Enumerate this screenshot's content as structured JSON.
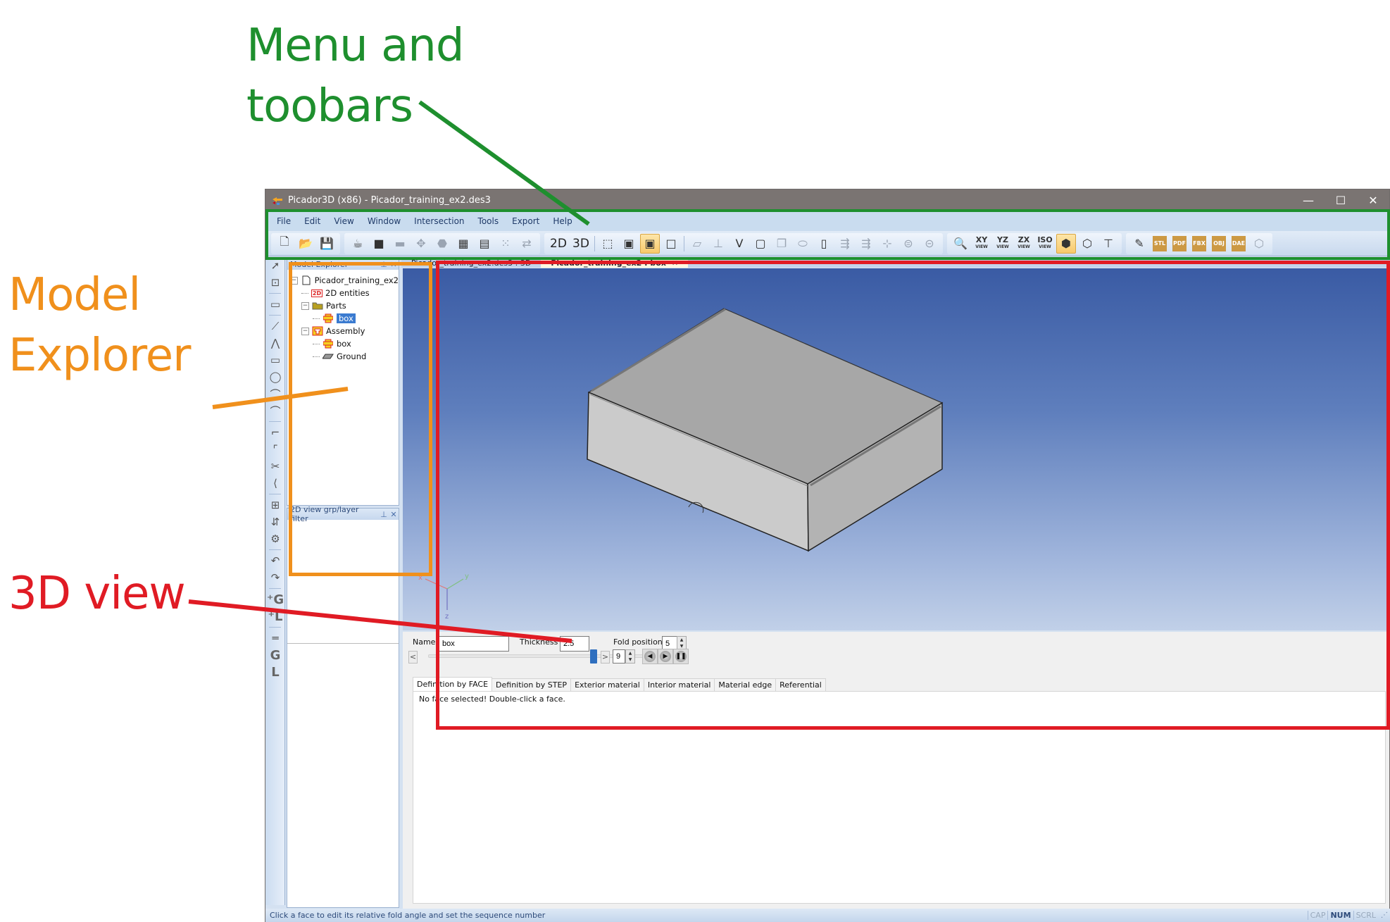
{
  "annotations": {
    "menu_toolbars": [
      "Menu and",
      "toobars"
    ],
    "model_explorer": [
      "Model",
      "Explorer"
    ],
    "view3d": "3D view",
    "colors": {
      "green": "#1e8f2e",
      "orange": "#f0901c",
      "red": "#e01b24"
    }
  },
  "window": {
    "title": "Picador3D (x86) - Picador_training_ex2.des3",
    "controls": {
      "minimize": "—",
      "maximize": "☐",
      "close": "✕"
    }
  },
  "menu": [
    "File",
    "Edit",
    "View",
    "Window",
    "Intersection",
    "Tools",
    "Export",
    "Help"
  ],
  "toolbar": {
    "file_group": [
      {
        "name": "new-document-icon",
        "glyph": "🗋"
      },
      {
        "name": "open-file-icon",
        "glyph": "📂"
      },
      {
        "name": "save-icon",
        "glyph": "💾"
      }
    ],
    "model_group": [
      {
        "name": "teapot-icon",
        "glyph": "☕"
      },
      {
        "name": "solid-3d-icon",
        "glyph": "■"
      },
      {
        "name": "mold-icon",
        "glyph": "▬",
        "disabled": true
      },
      {
        "name": "rotate-part-icon",
        "glyph": "✥",
        "disabled": true
      },
      {
        "name": "shape-icon",
        "glyph": "⬣",
        "disabled": true
      },
      {
        "name": "parts-stack-icon",
        "glyph": "▦"
      },
      {
        "name": "parts-group-icon",
        "glyph": "▤"
      },
      {
        "name": "grid-parts-icon",
        "glyph": "⁙",
        "disabled": true
      },
      {
        "name": "swap-icon",
        "glyph": "⇄",
        "disabled": true
      }
    ],
    "mode_2d": "2D",
    "mode_3d": "3D",
    "render_group": [
      {
        "name": "wireframe-icon",
        "glyph": "⬚"
      },
      {
        "name": "shaded-box-icon",
        "glyph": "▣"
      },
      {
        "name": "shaded-edges-icon",
        "glyph": "▣",
        "active": true
      },
      {
        "name": "hidden-lines-icon",
        "glyph": "□"
      }
    ],
    "fold_group": [
      {
        "name": "parts-icon",
        "glyph": "▱",
        "disabled": true
      },
      {
        "name": "dimension-icon",
        "glyph": "⊥",
        "disabled": true
      },
      {
        "name": "fold-icon",
        "glyph": "V"
      },
      {
        "name": "box-select-icon",
        "glyph": "▢"
      },
      {
        "name": "copy-icon",
        "glyph": "❐",
        "disabled": true
      },
      {
        "name": "flatten-icon",
        "glyph": "⬭",
        "disabled": true
      },
      {
        "name": "cut-box-icon",
        "glyph": "▯"
      },
      {
        "name": "align-h-icon",
        "glyph": "⇶",
        "disabled": true
      },
      {
        "name": "align-v-icon",
        "glyph": "⇶",
        "disabled": true
      },
      {
        "name": "axis-icon",
        "glyph": "⊹",
        "disabled": true
      },
      {
        "name": "hang-icon",
        "glyph": "⊜",
        "disabled": true
      },
      {
        "name": "hang-alt-icon",
        "glyph": "⊝",
        "disabled": true
      }
    ],
    "view_group": [
      {
        "name": "zoom-icon",
        "glyph": "🔍"
      },
      {
        "name": "xy-view-icon",
        "label": "XY",
        "sub": "VIEW"
      },
      {
        "name": "yz-view-icon",
        "label": "YZ",
        "sub": "VIEW"
      },
      {
        "name": "zx-view-icon",
        "label": "ZX",
        "sub": "VIEW"
      },
      {
        "name": "iso-view-icon",
        "label": "ISO",
        "sub": "VIEW"
      },
      {
        "name": "perspective-cube-icon",
        "glyph": "⬢",
        "active": true
      },
      {
        "name": "explode-cube-icon",
        "glyph": "⬡"
      },
      {
        "name": "presentation-icon",
        "glyph": "⊤"
      }
    ],
    "export_group": [
      {
        "name": "edit-sign-icon",
        "glyph": "✎"
      },
      {
        "name": "export-stl-icon",
        "glyph": "STL"
      },
      {
        "name": "export-3dpdf-icon",
        "glyph": "PDF"
      },
      {
        "name": "export-fbx-icon",
        "glyph": "FBX"
      },
      {
        "name": "export-obj-icon",
        "glyph": "OBJ"
      },
      {
        "name": "export-dae-icon",
        "glyph": "DAE"
      },
      {
        "name": "hexagon-icon",
        "glyph": "⬡",
        "disabled": true
      }
    ]
  },
  "leftstrip": [
    {
      "name": "select-arrow-icon",
      "glyph": "➚"
    },
    {
      "name": "resize-sheet-icon",
      "glyph": "⊡"
    },
    {
      "sep": true
    },
    {
      "name": "eraser-icon",
      "glyph": "▭"
    },
    {
      "sep": true
    },
    {
      "name": "line-icon",
      "glyph": "⟋"
    },
    {
      "name": "polyline-icon",
      "glyph": "⋀"
    },
    {
      "name": "rectangle-icon",
      "glyph": "▭"
    },
    {
      "name": "circle-icon",
      "glyph": "◯"
    },
    {
      "name": "arc-icon",
      "glyph": "⌒"
    },
    {
      "name": "arc-3pt-icon",
      "glyph": "⌒"
    },
    {
      "sep": true
    },
    {
      "name": "corner-icon",
      "glyph": "⌐"
    },
    {
      "name": "fillet-icon",
      "glyph": "⌜"
    },
    {
      "name": "scissors-icon",
      "glyph": "✂"
    },
    {
      "name": "chamfer-icon",
      "glyph": "⟨"
    },
    {
      "sep": true
    },
    {
      "name": "crop-icon",
      "glyph": "⊞"
    },
    {
      "name": "flip-icon",
      "glyph": "⇵"
    },
    {
      "name": "machine-icon",
      "glyph": "⚙"
    },
    {
      "sep": true
    },
    {
      "name": "undo-icon",
      "glyph": "↶"
    },
    {
      "name": "redo-icon",
      "glyph": "↷"
    },
    {
      "sep": true
    },
    {
      "name": "add-group-icon",
      "glyph": "⁺G",
      "bold": true
    },
    {
      "name": "add-layer-icon",
      "glyph": "⁺L",
      "bold": true
    },
    {
      "sep": true
    },
    {
      "name": "parallel-icon",
      "glyph": "═"
    },
    {
      "name": "group-icon",
      "glyph": "G",
      "bold": true
    },
    {
      "name": "layer-icon",
      "glyph": "L",
      "bold": true
    }
  ],
  "model_explorer": {
    "title": "Model Explorer",
    "pin": "⊥",
    "close": "✕",
    "tree": [
      {
        "label": "Picador_training_ex2",
        "level": 0,
        "toggle": "−",
        "icon": "document"
      },
      {
        "label": "2D entities",
        "level": 1,
        "icon": "2d"
      },
      {
        "label": "Parts",
        "level": 1,
        "toggle": "−",
        "icon": "folder"
      },
      {
        "label": "box",
        "level": 2,
        "icon": "part",
        "selected": true
      },
      {
        "label": "Assembly",
        "level": 1,
        "toggle": "−",
        "icon": "assembly"
      },
      {
        "label": "box",
        "level": 2,
        "icon": "part"
      },
      {
        "label": "Ground",
        "level": 2,
        "icon": "ground"
      }
    ]
  },
  "layer_filter": {
    "title": "2D view grp/layer filter",
    "pin": "⊥",
    "close": "✕"
  },
  "doc_tabs": [
    {
      "label": "Picador_training_ex2.des3 : 3D",
      "active": false
    },
    {
      "label": "Picador_training_ex2 : box",
      "active": true,
      "close": "✕"
    }
  ],
  "view3d": {
    "axes": {
      "x": "x",
      "y": "y",
      "z": "z"
    }
  },
  "properties": {
    "name_label": "Name",
    "name_value": "box",
    "thickness_label": "Thickness",
    "thickness_value": "2.5",
    "fold_position_label": "Fold position",
    "fold_position_value": "5",
    "step_value": "9",
    "slider_fraction": 1.0,
    "prev": "<",
    "next": ">",
    "tabs": [
      "Definition by FACE",
      "Definition by STEP",
      "Exterior material",
      "Interior material",
      "Material edge",
      "Referential"
    ],
    "active_tab": 0,
    "message": "No face selected! Double-click a face."
  },
  "statusbar": {
    "message": "Click a face to edit its relative fold angle and set the sequence number",
    "indicators": [
      {
        "label": "CAP",
        "on": false
      },
      {
        "label": "NUM",
        "on": true
      },
      {
        "label": "SCRL",
        "on": false
      }
    ]
  }
}
